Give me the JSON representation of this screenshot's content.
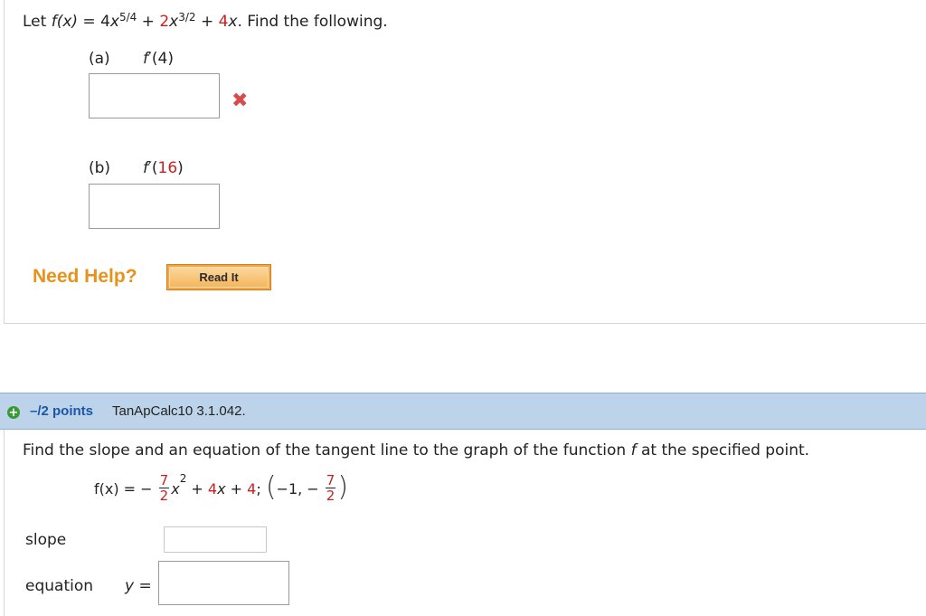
{
  "question1": {
    "intro_pre": "Let ",
    "fx": "f(x)",
    "eq": " = ",
    "t1_coef": "4",
    "t1_var": "x",
    "t1_exp": "5/4",
    "plus1": " + ",
    "t2_coef": "2",
    "t2_var": "x",
    "t2_exp": "3/2",
    "plus2": " + ",
    "t3_coef": "4",
    "t3_var": "x",
    "intro_post": ". Find the following.",
    "part_a": {
      "label": "(a)",
      "expr_f": "f",
      "expr_prime": "′",
      "expr_open": "(",
      "expr_val": "4",
      "expr_close": ")",
      "answer_value": "",
      "status_icon": "✖"
    },
    "part_b": {
      "label": "(b)",
      "expr_f": "f",
      "expr_prime": "′",
      "expr_open": "(",
      "expr_val": "16",
      "expr_close": ")",
      "answer_value": ""
    },
    "need_help": "Need Help?",
    "read_it": "Read It"
  },
  "question2": {
    "plus_icon": "+",
    "points": "–/2 points",
    "question_id": "TanApCalc10 3.1.042.",
    "prompt_pre": "Find the slope and an equation of the tangent line to the graph of the function ",
    "prompt_var": "f",
    "prompt_post": " at the specified point.",
    "function": {
      "fx": "f(x)",
      "eq": " = − ",
      "frac1_num": "7",
      "frac1_den": "2",
      "x2_var": "x",
      "x2_exp": "2",
      "plus1": " + ",
      "t2_coef": "4",
      "t2_var": "x",
      "plus2": " + ",
      "t3": "4",
      "semi": ";",
      "point_open": "(",
      "point_x": "−1,",
      "point_minus": " − ",
      "frac2_num": "7",
      "frac2_den": "2",
      "point_close": ")"
    },
    "slope_label": "slope",
    "slope_value": "",
    "equation_label": "equation",
    "y_label": "y",
    "y_eq": " =",
    "equation_value": ""
  },
  "colors": {
    "accent_red": "#c8211f",
    "help_orange": "#e8911b",
    "header_blue": "#bcd3e9",
    "points_blue": "#1a57a8",
    "plus_green": "#3a9a3a"
  }
}
